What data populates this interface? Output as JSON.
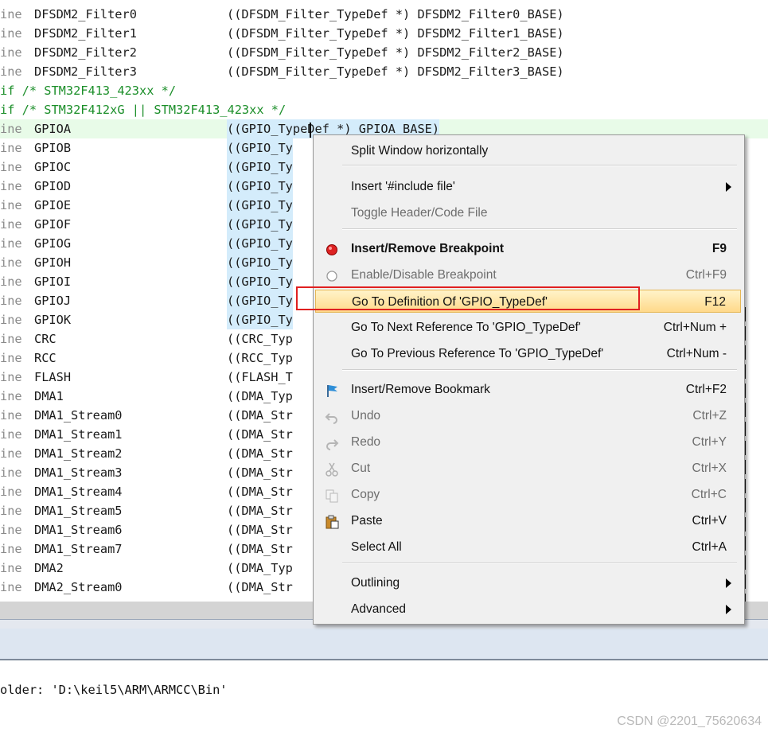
{
  "code_lines": [
    {
      "kw": "ine",
      "name": "DFSDM2_Filter0",
      "val": "((DFSDM_Filter_TypeDef *) DFSDM2_Filter0_BASE)"
    },
    {
      "kw": "ine",
      "name": "DFSDM2_Filter1",
      "val": "((DFSDM_Filter_TypeDef *) DFSDM2_Filter1_BASE)"
    },
    {
      "kw": "ine",
      "name": "DFSDM2_Filter2",
      "val": "((DFSDM_Filter_TypeDef *) DFSDM2_Filter2_BASE)"
    },
    {
      "kw": "ine",
      "name": "DFSDM2_Filter3",
      "val": "((DFSDM_Filter_TypeDef *) DFSDM2_Filter3_BASE)"
    },
    {
      "pre": "if /* STM32F413_423xx */"
    },
    {
      "pre": "if /* STM32F412xG || STM32F413_423xx */"
    },
    {
      "kw": "ine",
      "name": "GPIOA",
      "val": "((GPIO_TypeDef *) GPIOA_BASE)"
    },
    {
      "kw": "ine",
      "name": "GPIOB",
      "val": "((GPIO_Ty"
    },
    {
      "kw": "ine",
      "name": "GPIOC",
      "val": "((GPIO_Ty"
    },
    {
      "kw": "ine",
      "name": "GPIOD",
      "val": "((GPIO_Ty"
    },
    {
      "kw": "ine",
      "name": "GPIOE",
      "val": "((GPIO_Ty"
    },
    {
      "kw": "ine",
      "name": "GPIOF",
      "val": "((GPIO_Ty"
    },
    {
      "kw": "ine",
      "name": "GPIOG",
      "val": "((GPIO_Ty"
    },
    {
      "kw": "ine",
      "name": "GPIOH",
      "val": "((GPIO_Ty"
    },
    {
      "kw": "ine",
      "name": "GPIOI",
      "val": "((GPIO_Ty"
    },
    {
      "kw": "ine",
      "name": "GPIOJ",
      "val": "((GPIO_Ty"
    },
    {
      "kw": "ine",
      "name": "GPIOK",
      "val": "((GPIO_Ty"
    },
    {
      "kw": "ine",
      "name": "CRC",
      "val": "((CRC_Typ"
    },
    {
      "kw": "ine",
      "name": "RCC",
      "val": "((RCC_Typ"
    },
    {
      "kw": "ine",
      "name": "FLASH",
      "val": "((FLASH_T"
    },
    {
      "kw": "ine",
      "name": "DMA1",
      "val": "((DMA_Typ"
    },
    {
      "kw": "ine",
      "name": "DMA1_Stream0",
      "val": "((DMA_Str"
    },
    {
      "kw": "ine",
      "name": "DMA1_Stream1",
      "val": "((DMA_Str"
    },
    {
      "kw": "ine",
      "name": "DMA1_Stream2",
      "val": "((DMA_Str"
    },
    {
      "kw": "ine",
      "name": "DMA1_Stream3",
      "val": "((DMA_Str"
    },
    {
      "kw": "ine",
      "name": "DMA1_Stream4",
      "val": "((DMA_Str"
    },
    {
      "kw": "ine",
      "name": "DMA1_Stream5",
      "val": "((DMA_Str"
    },
    {
      "kw": "ine",
      "name": "DMA1_Stream6",
      "val": "((DMA_Str"
    },
    {
      "kw": "ine",
      "name": "DMA1_Stream7",
      "val": "((DMA_Str"
    },
    {
      "kw": "ine",
      "name": "DMA2",
      "val": "((DMA_Typ"
    },
    {
      "kw": "ine",
      "name": "DMA2_Stream0",
      "val": "((DMA_Str"
    }
  ],
  "output_text": "older: 'D:\\keil5\\ARM\\ARMCC\\Bin'",
  "watermark": "CSDN @2201_75620634",
  "context_menu": {
    "items": [
      {
        "id": "split",
        "label": "Split Window horizontally",
        "shortcut": "",
        "icon": ""
      },
      {
        "id": "include",
        "label": "Insert '#include file'",
        "shortcut": "",
        "submenu": true
      },
      {
        "id": "toggle",
        "label": "Toggle Header/Code File",
        "shortcut": "",
        "disabled": true
      },
      {
        "id": "bp",
        "label": "Insert/Remove Breakpoint",
        "shortcut": "F9",
        "bold": true,
        "icon": "breakpoint-icon"
      },
      {
        "id": "enbp",
        "label": "Enable/Disable Breakpoint",
        "shortcut": "Ctrl+F9",
        "disabled": true,
        "icon": "breakpoint-outline-icon"
      },
      {
        "id": "goto",
        "label": "Go To Definition Of 'GPIO_TypeDef'",
        "shortcut": "F12",
        "hover": true
      },
      {
        "id": "next",
        "label": "Go To Next Reference To 'GPIO_TypeDef'",
        "shortcut": "Ctrl+Num +"
      },
      {
        "id": "prev",
        "label": "Go To Previous Reference To 'GPIO_TypeDef'",
        "shortcut": "Ctrl+Num -"
      },
      {
        "id": "bookmark",
        "label": "Insert/Remove Bookmark",
        "shortcut": "Ctrl+F2",
        "icon": "bookmark-flag-icon"
      },
      {
        "id": "undo",
        "label": "Undo",
        "shortcut": "Ctrl+Z",
        "disabled": true,
        "icon": "undo-icon"
      },
      {
        "id": "redo",
        "label": "Redo",
        "shortcut": "Ctrl+Y",
        "disabled": true,
        "icon": "redo-icon"
      },
      {
        "id": "cut",
        "label": "Cut",
        "shortcut": "Ctrl+X",
        "disabled": true,
        "icon": "cut-icon"
      },
      {
        "id": "copy",
        "label": "Copy",
        "shortcut": "Ctrl+C",
        "disabled": true,
        "icon": "copy-icon"
      },
      {
        "id": "paste",
        "label": "Paste",
        "shortcut": "Ctrl+V",
        "icon": "paste-icon"
      },
      {
        "id": "selall",
        "label": "Select All",
        "shortcut": "Ctrl+A"
      },
      {
        "id": "outlining",
        "label": "Outlining",
        "shortcut": "",
        "submenu": true
      },
      {
        "id": "advanced",
        "label": "Advanced",
        "shortcut": "",
        "submenu": true
      }
    ]
  }
}
